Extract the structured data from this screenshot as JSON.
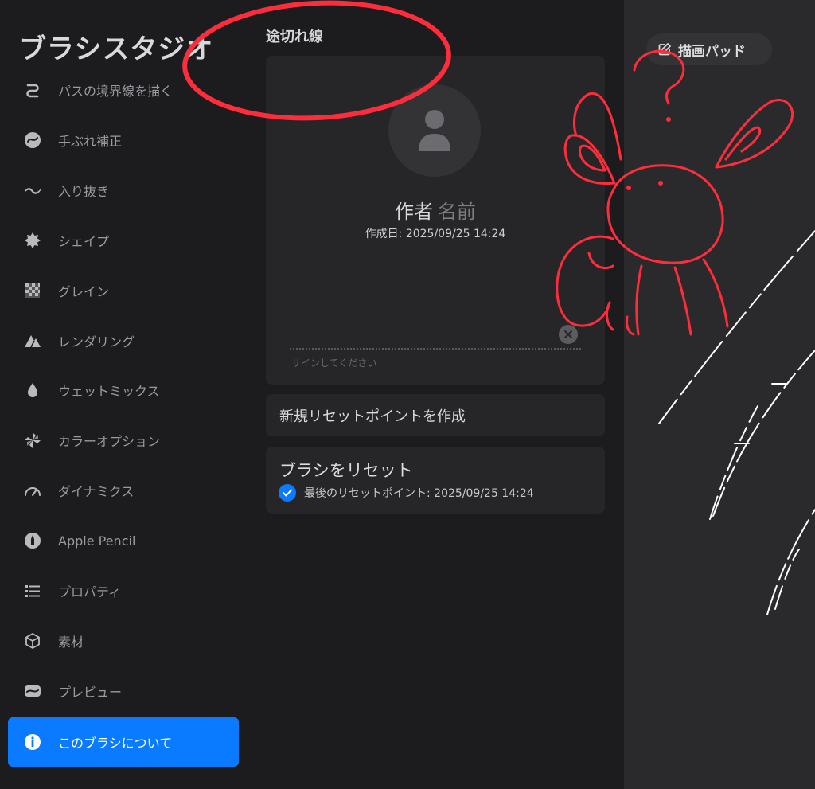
{
  "sidebar": {
    "title": "ブラシスタジオ",
    "items": [
      {
        "label": "パスの境界線を描く",
        "icon": "stroke-path-icon"
      },
      {
        "label": "手ぶれ補正",
        "icon": "stabilization-icon"
      },
      {
        "label": "入り抜き",
        "icon": "taper-icon"
      },
      {
        "label": "シェイプ",
        "icon": "shape-icon"
      },
      {
        "label": "グレイン",
        "icon": "grain-icon"
      },
      {
        "label": "レンダリング",
        "icon": "rendering-icon"
      },
      {
        "label": "ウェットミックス",
        "icon": "wet-mix-icon"
      },
      {
        "label": "カラーオプション",
        "icon": "color-options-icon"
      },
      {
        "label": "ダイナミクス",
        "icon": "dynamics-icon"
      },
      {
        "label": "Apple Pencil",
        "icon": "apple-pencil-icon"
      },
      {
        "label": "プロパティ",
        "icon": "properties-icon"
      },
      {
        "label": "素材",
        "icon": "materials-icon"
      },
      {
        "label": "プレビュー",
        "icon": "preview-icon"
      },
      {
        "label": "このブラシについて",
        "icon": "info-icon",
        "active": true
      }
    ]
  },
  "main": {
    "brush_name": "途切れ線",
    "author_label": "作者",
    "author_placeholder": "名前",
    "created": "作成日: 2025/09/25 14:24",
    "signature_hint": "サインしてください",
    "create_reset_point": "新規リセットポイントを作成",
    "reset_brush": "ブラシをリセット",
    "last_reset_point": "最後のリセットポイント: 2025/09/25 14:24"
  },
  "drawing_pad": {
    "button_label": "描画パッド"
  },
  "colors": {
    "accent": "#0a7aff",
    "annotation": "#ff2d3c",
    "background": "#1c1c1e",
    "card": "#262628",
    "pad": "#2a2a2c"
  }
}
